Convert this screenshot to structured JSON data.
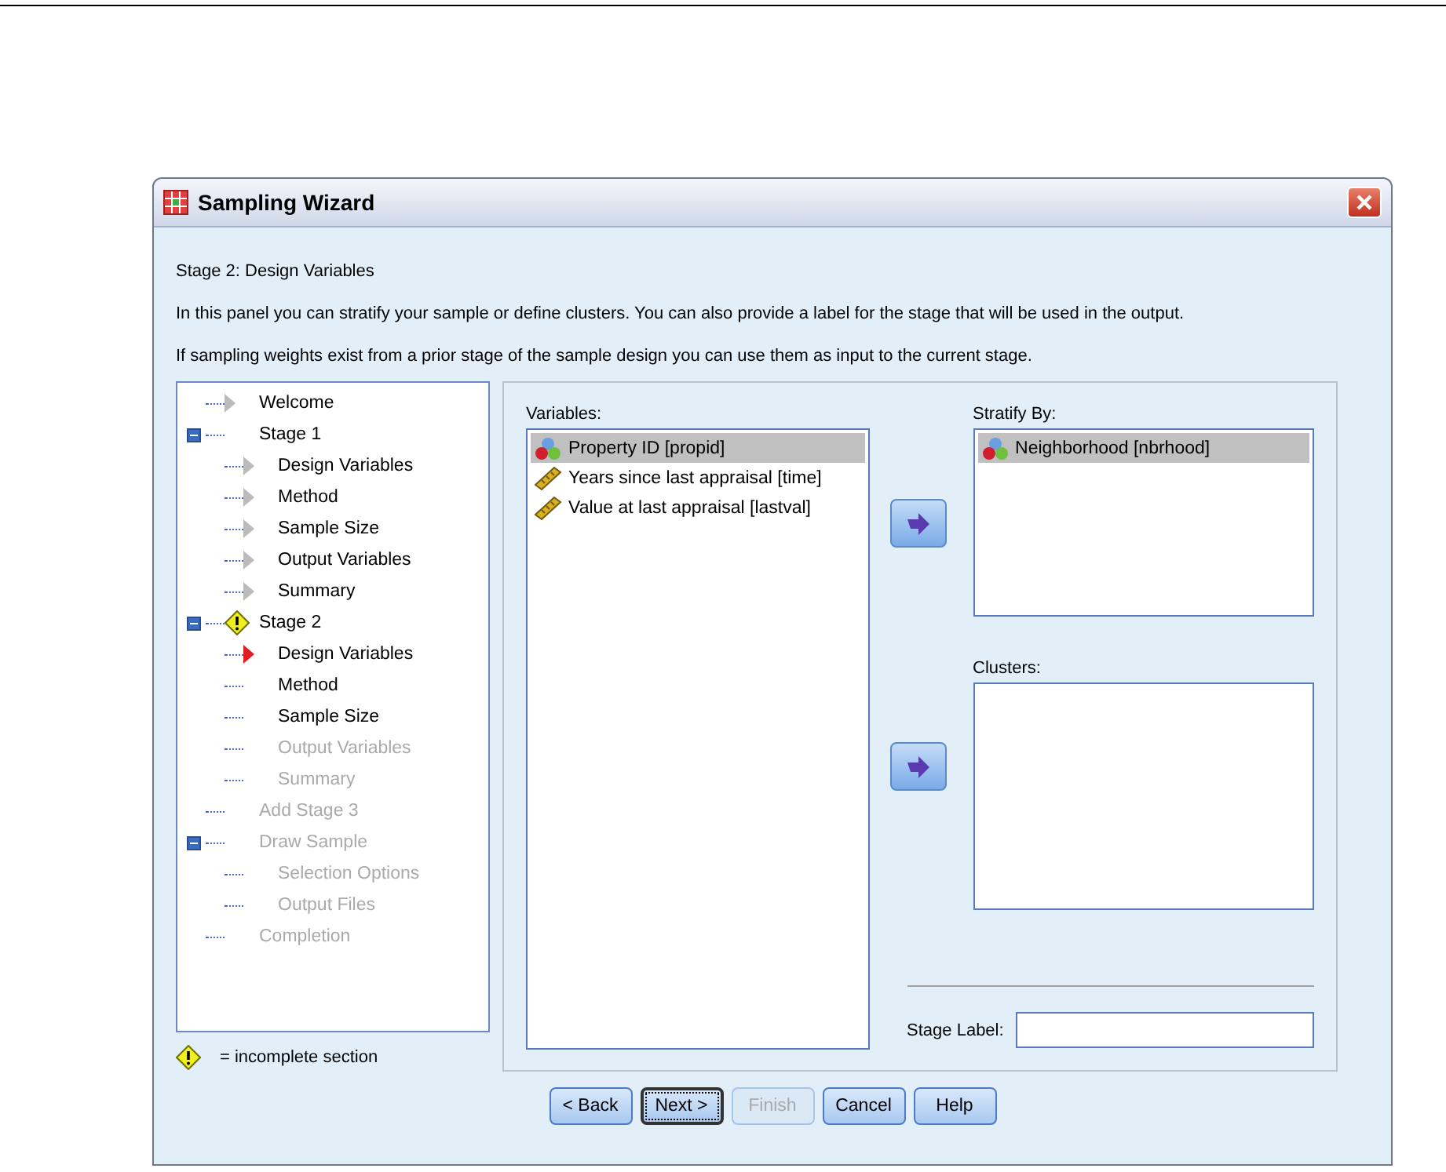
{
  "window": {
    "title": "Sampling Wizard"
  },
  "heading": "Stage 2: Design Variables",
  "intro": [
    "In this panel you can stratify your sample or define clusters. You can also provide a label for the stage that will be used in the output.",
    "If sampling weights exist from a prior stage of the sample design you can use them as input to the current stage."
  ],
  "tree": [
    {
      "label": "Welcome",
      "kind": "visited",
      "disabled": false
    },
    {
      "label": "Stage 1",
      "kind": "plain",
      "disabled": false,
      "expanded": true,
      "incomplete": false,
      "children": [
        {
          "label": "Design Variables",
          "kind": "visited",
          "disabled": false
        },
        {
          "label": "Method",
          "kind": "visited",
          "disabled": false
        },
        {
          "label": "Sample Size",
          "kind": "visited",
          "disabled": false
        },
        {
          "label": "Output Variables",
          "kind": "visited",
          "disabled": false
        },
        {
          "label": "Summary",
          "kind": "visited",
          "disabled": false
        }
      ]
    },
    {
      "label": "Stage 2",
      "kind": "plain",
      "disabled": false,
      "expanded": true,
      "incomplete": true,
      "children": [
        {
          "label": "Design Variables",
          "kind": "current",
          "disabled": false
        },
        {
          "label": "Method",
          "kind": "plain",
          "disabled": false
        },
        {
          "label": "Sample Size",
          "kind": "plain",
          "disabled": false
        },
        {
          "label": "Output Variables",
          "kind": "plain",
          "disabled": true
        },
        {
          "label": "Summary",
          "kind": "plain",
          "disabled": true
        }
      ]
    },
    {
      "label": "Add Stage 3",
      "kind": "plain",
      "disabled": true
    },
    {
      "label": "Draw Sample",
      "kind": "plain",
      "disabled": true,
      "expanded": true,
      "incomplete": false,
      "children": [
        {
          "label": "Selection Options",
          "kind": "plain",
          "disabled": true
        },
        {
          "label": "Output Files",
          "kind": "plain",
          "disabled": true
        }
      ]
    },
    {
      "label": "Completion",
      "kind": "plain",
      "disabled": true
    }
  ],
  "legend": "= incomplete section",
  "variables": {
    "label": "Variables:",
    "items": [
      {
        "name": "Property ID [propid]",
        "kind": "nominal",
        "selected": true
      },
      {
        "name": "Years since last appraisal [time]",
        "kind": "scale",
        "selected": false
      },
      {
        "name": "Value at last appraisal [lastval]",
        "kind": "scale",
        "selected": false
      }
    ]
  },
  "stratify": {
    "label": "Stratify By:",
    "items": [
      {
        "name": "Neighborhood [nbrhood]",
        "kind": "nominal",
        "selected": true
      }
    ]
  },
  "clusters": {
    "label": "Clusters:"
  },
  "stage_label": {
    "label": "Stage Label:"
  },
  "buttons": [
    {
      "label": "< Back",
      "disabled": false,
      "focused": false
    },
    {
      "label": "Next >",
      "disabled": false,
      "focused": true
    },
    {
      "label": "Finish",
      "disabled": true,
      "focused": false
    },
    {
      "label": "Cancel",
      "disabled": false,
      "focused": false
    },
    {
      "label": "Help",
      "disabled": false,
      "focused": false
    }
  ]
}
